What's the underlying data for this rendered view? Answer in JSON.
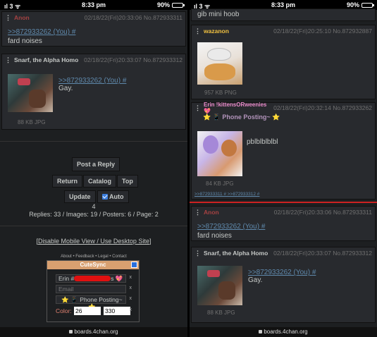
{
  "left_phone": {
    "status": {
      "carrier": "ıl 3 ᯤ",
      "time": "8:33 pm",
      "battery": "90%"
    },
    "posts": [
      {
        "name": "Anon",
        "date": "02/18/22(Fri)20:33:06",
        "no": "No.872933311",
        "quote": ">>872933262 (You) #",
        "text": "fard noises"
      },
      {
        "name": "Snarf, the Alpha Homo",
        "date": "02/18/22(Fri)20:33:07",
        "no": "No.872933312",
        "quote": ">>872933262 (You) #",
        "text": "Gay.",
        "file": "88 KB JPG"
      }
    ],
    "controls": {
      "post_reply": "Post a Reply",
      "return": "Return",
      "catalog": "Catalog",
      "top": "Top",
      "update": "Update",
      "auto": "Auto",
      "countdown": "4",
      "stats": "Replies: 33 / Images: 19 / Posters: 6 / Page: 2",
      "desktop_link": "Disable Mobile View / Use Desktop Site",
      "footer_links": "About • Feedback • Legal • Contact"
    },
    "quick_reply": {
      "title": "CuteSync",
      "name_prefix": "Erin #",
      "name_suffix": "s 💖",
      "email_placeholder": "Email",
      "subject": "⭐ 📱 Phone Posting~ ⭐",
      "color_label": "Color:",
      "color_a": "26",
      "color_b": "330",
      "close": "x"
    },
    "url": "boards.4chan.org"
  },
  "right_phone": {
    "status": {
      "carrier": "ıl 3 ᯤ",
      "time": "8:33 pm",
      "battery": "90%"
    },
    "top_text": "gib mini hoob",
    "posts": [
      {
        "name": "wazanon",
        "date": "02/18/22(Fri)20:25:10",
        "no": "No.872932887",
        "file": "957 KB PNG"
      },
      {
        "name": "Erin !kittensORweenies 💖",
        "date": "02/18/22(Fri)20:32:14",
        "no": "No.872933262",
        "subject": "⭐ 📱 Phone Posting~ ⭐",
        "text": "pblblblblbl",
        "file": "84 KB JPG",
        "backlinks": ">>872933311 # >>872933312 #"
      },
      {
        "name": "Anon",
        "date": "02/18/22(Fri)20:33:06",
        "no": "No.872933311",
        "quote": ">>872933262 (You) #",
        "text": "fard noises"
      },
      {
        "name": "Snarf, the Alpha Homo",
        "date": "02/18/22(Fri)20:33:07",
        "no": "No.872933312",
        "quote": ">>872933262 (You) #",
        "text": "Gay.",
        "file": "88 KB JPG"
      }
    ],
    "url": "boards.4chan.org"
  },
  "colors": {
    "bg": "#1d1f21",
    "post_bg": "#282a2e",
    "quote": "#5f89ac",
    "name_red": "#a54242",
    "divider_red": "#cc2222"
  }
}
